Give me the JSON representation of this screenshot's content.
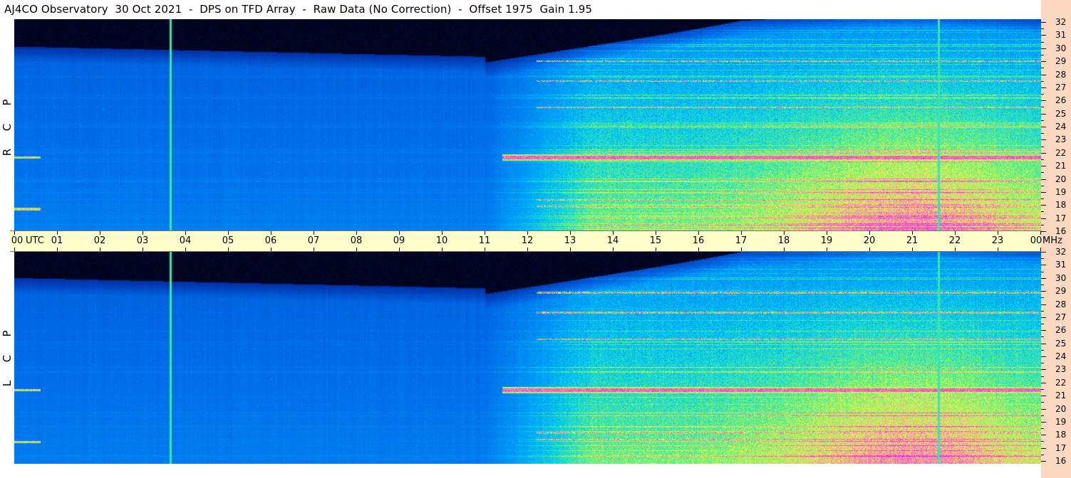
{
  "title": "AJ4CO Observatory  30 Oct 2021  -  DPS on TFD Array  -  Raw Data (No Correction)  -  Offset 1975  Gain 1.95",
  "panels": [
    {
      "polarization": "RCP",
      "letters": [
        "R",
        "C",
        "P"
      ]
    },
    {
      "polarization": "LCP",
      "letters": [
        "L",
        "C",
        "P"
      ]
    }
  ],
  "time_axis": {
    "unit_label": "UTC",
    "freq_unit_label": "MHz",
    "ticks": [
      "00",
      "01",
      "02",
      "03",
      "04",
      "05",
      "06",
      "07",
      "08",
      "09",
      "10",
      "11",
      "12",
      "13",
      "14",
      "15",
      "16",
      "17",
      "18",
      "19",
      "20",
      "21",
      "22",
      "23",
      "00"
    ]
  },
  "colors": {
    "background": "#ffffff",
    "time_axis_bg": "#ffffcc",
    "freq_axis_bg": "#fbd9c0"
  },
  "chart_data": {
    "type": "heatmap",
    "title": "AJ4CO Observatory  30 Oct 2021  -  DPS on TFD Array  -  Raw Data (No Correction)  -  Offset 1975  Gain 1.95",
    "x": {
      "label": "UTC",
      "range_hours": [
        0,
        24
      ],
      "tick_labels": [
        "00",
        "01",
        "02",
        "03",
        "04",
        "05",
        "06",
        "07",
        "08",
        "09",
        "10",
        "11",
        "12",
        "13",
        "14",
        "15",
        "16",
        "17",
        "18",
        "19",
        "20",
        "21",
        "22",
        "23",
        "00"
      ]
    },
    "y": {
      "label": "MHz",
      "range": [
        16,
        32
      ],
      "tick_labels": [
        16,
        17,
        18,
        19,
        20,
        21,
        22,
        23,
        24,
        25,
        26,
        27,
        28,
        29,
        30,
        31,
        32
      ]
    },
    "series": [
      {
        "name": "RCP"
      },
      {
        "name": "LCP"
      }
    ],
    "features": {
      "vertical_interference_lines_utc": [
        3.65,
        21.6
      ],
      "strong_horizontal_band_mhz": 21.2,
      "secondary_bands_mhz": [
        17.5,
        18.0,
        25.0,
        27.0,
        28.5
      ],
      "daytime_enhancement_utc": [
        11,
        24
      ]
    }
  }
}
